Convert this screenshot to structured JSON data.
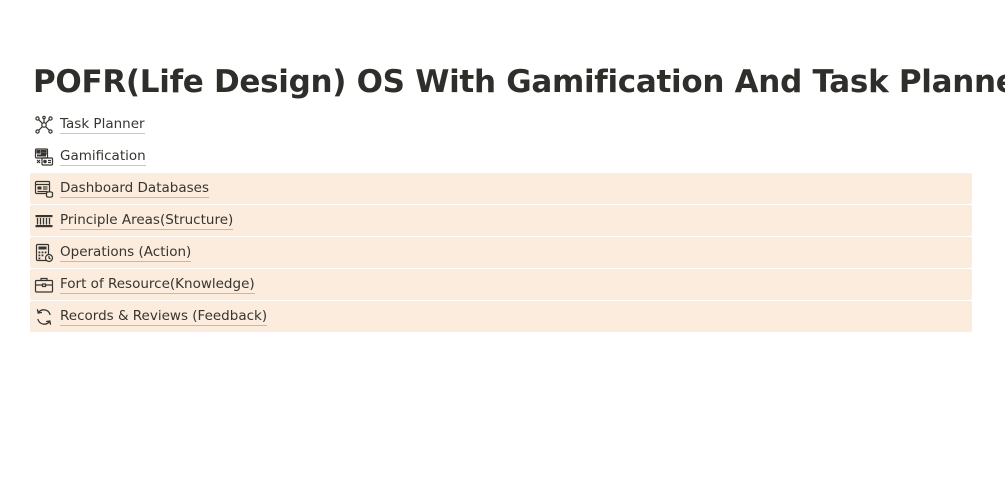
{
  "page": {
    "title": "POFR(Life Design) OS With Gamification And Task Planner"
  },
  "links": [
    {
      "label": "Task Planner",
      "icon": "network-icon",
      "highlighted": false
    },
    {
      "label": "Gamification",
      "icon": "game-dashboard-icon",
      "highlighted": false
    },
    {
      "label": "Dashboard Databases",
      "icon": "dashboard-database-icon",
      "highlighted": true
    },
    {
      "label": "Principle Areas(Structure)",
      "icon": "structure-columns-icon",
      "highlighted": true
    },
    {
      "label": "Operations (Action)",
      "icon": "calculator-icon",
      "highlighted": true
    },
    {
      "label": "Fort of Resource(Knowledge)",
      "icon": "briefcase-icon",
      "highlighted": true
    },
    {
      "label": "Records & Reviews (Feedback)",
      "icon": "refresh-icon",
      "highlighted": true
    }
  ],
  "colors": {
    "highlight_background": "#fbecdd",
    "text": "#37352f"
  }
}
